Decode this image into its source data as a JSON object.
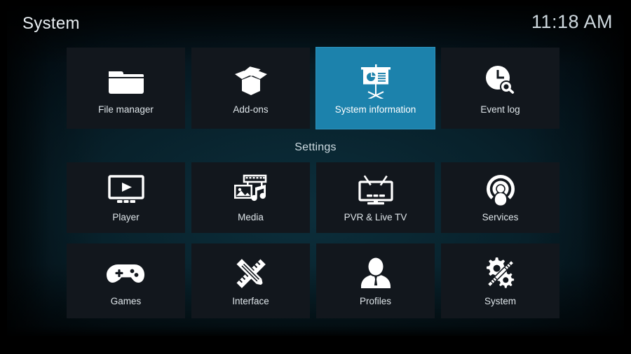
{
  "header": {
    "title": "System",
    "clock": "11:18 AM"
  },
  "sections": {
    "settings_label": "Settings"
  },
  "colors": {
    "focus_blue": "#1c82ac",
    "tile_background": "#12171d",
    "text": "#dfe6ea",
    "background_dark": "#04121a"
  },
  "top_row": {
    "tiles": [
      {
        "label": "File manager",
        "icon": "folder-icon",
        "focused": false
      },
      {
        "label": "Add-ons",
        "icon": "open-box-icon",
        "focused": false
      },
      {
        "label": "System information",
        "icon": "presentation-board-icon",
        "focused": true
      },
      {
        "label": "Event log",
        "icon": "clock-search-icon",
        "focused": false
      }
    ]
  },
  "settings_grid": {
    "rows": [
      {
        "tiles": [
          {
            "label": "Player",
            "icon": "monitor-play-icon",
            "focused": false
          },
          {
            "label": "Media",
            "icon": "media-library-icon",
            "focused": false
          },
          {
            "label": "PVR & Live TV",
            "icon": "tv-antenna-icon",
            "focused": false
          },
          {
            "label": "Services",
            "icon": "broadcast-user-icon",
            "focused": false
          }
        ]
      },
      {
        "tiles": [
          {
            "label": "Games",
            "icon": "gamepad-icon",
            "focused": false
          },
          {
            "label": "Interface",
            "icon": "pencil-ruler-icon",
            "focused": false
          },
          {
            "label": "Profiles",
            "icon": "user-bust-icon",
            "focused": false
          },
          {
            "label": "System",
            "icon": "gear-wrench-icon",
            "focused": false
          }
        ]
      }
    ]
  }
}
